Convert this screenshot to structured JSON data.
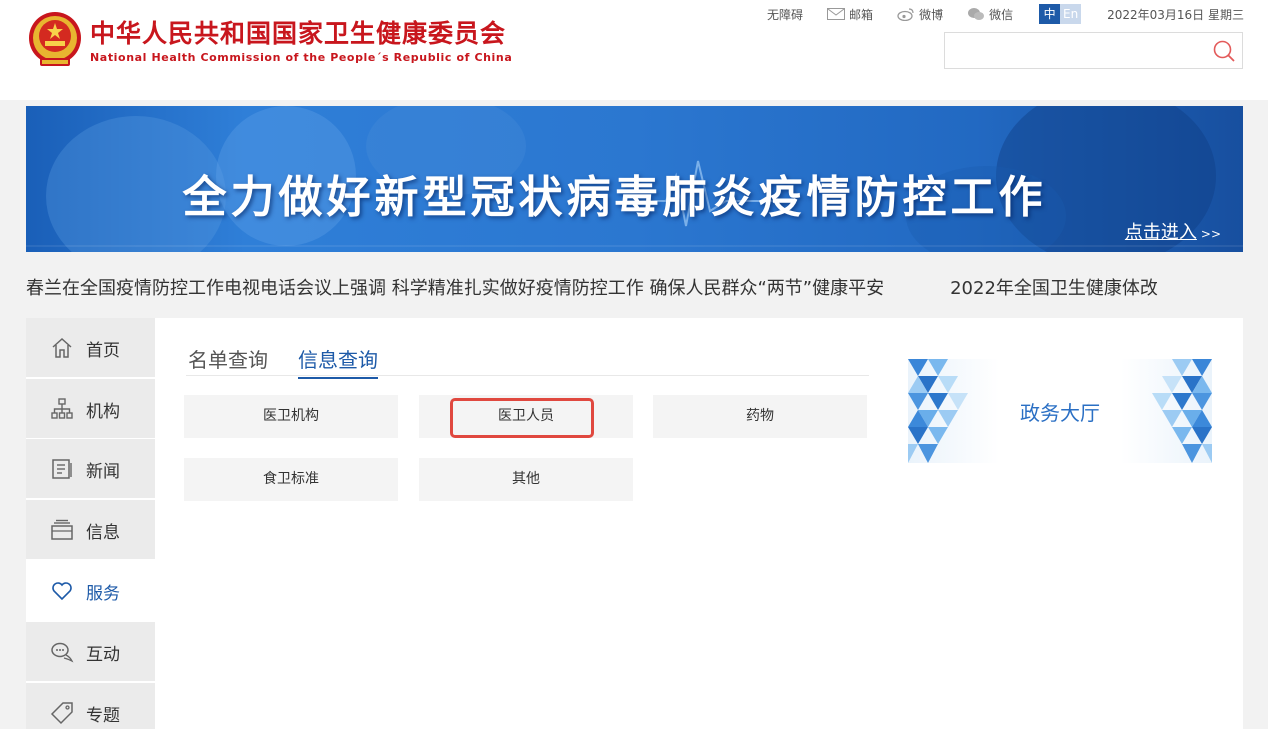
{
  "header": {
    "site_name_cn": "中华人民共和国国家卫生健康委员会",
    "site_name_en": "National Health Commission of the People´s Republic of China",
    "top_links": {
      "accessibility": "无障碍",
      "mail": "邮箱",
      "weibo": "微博",
      "wechat": "微信"
    },
    "lang_zh": "中",
    "lang_en": "En",
    "date": "2022年03月16日 星期三",
    "search_placeholder": ""
  },
  "banner": {
    "title": "全力做好新型冠状病毒肺炎疫情防控工作",
    "enter_label": "点击进入",
    "enter_arrow": ">>"
  },
  "ticker": {
    "items": [
      "春兰在全国疫情防控工作电视电话会议上强调 科学精准扎实做好疫情防控工作 确保人民群众“两节”健康平安",
      "2022年全国卫生健康体改"
    ]
  },
  "sidenav": {
    "items": [
      {
        "label": "首页",
        "icon": "home-icon"
      },
      {
        "label": "机构",
        "icon": "org-chart-icon"
      },
      {
        "label": "新闻",
        "icon": "news-icon"
      },
      {
        "label": "信息",
        "icon": "info-stack-icon"
      },
      {
        "label": "服务",
        "icon": "heart-icon"
      },
      {
        "label": "互动",
        "icon": "chat-icon"
      },
      {
        "label": "专题",
        "icon": "tag-icon"
      }
    ],
    "active_index": 4
  },
  "tabs": {
    "list_query": "名单查询",
    "info_query": "信息查询"
  },
  "query_buttons": {
    "medical_institution": "医卫机构",
    "medical_personnel": "医卫人员",
    "drugs": "药物",
    "food_standards": "食卫标准",
    "other": "其他"
  },
  "service_hall": {
    "label": "政务大厅"
  },
  "colors": {
    "brand_red": "#c8161d",
    "accent_blue": "#1d5aa8",
    "highlight_red": "#e0483f"
  }
}
